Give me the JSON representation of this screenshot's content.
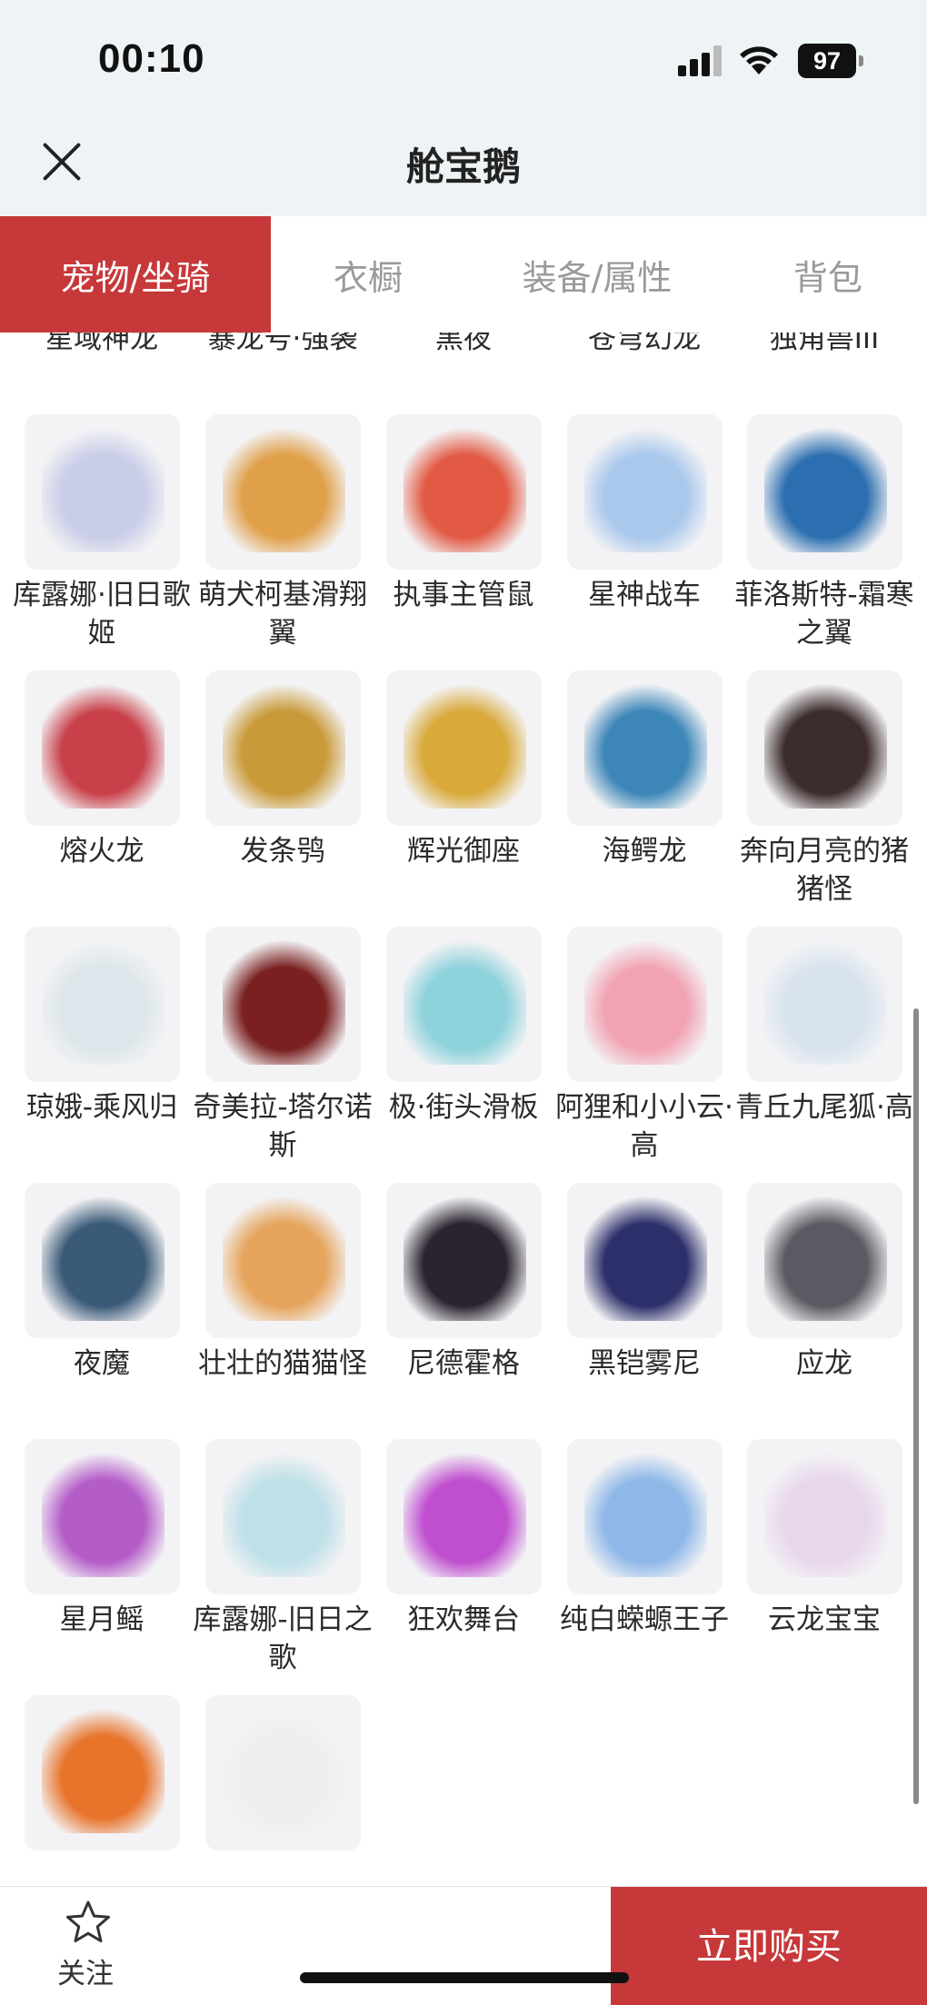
{
  "status_bar": {
    "time": "00:10",
    "battery": "97"
  },
  "header": {
    "title": "舱宝鹅",
    "close_icon": "close-icon"
  },
  "tabs": [
    {
      "label": "宠物/坐骑",
      "active": true
    },
    {
      "label": "衣橱",
      "active": false
    },
    {
      "label": "装备/属性",
      "active": false
    },
    {
      "label": "背包",
      "active": false
    }
  ],
  "items": [
    {
      "name": "星域神龙",
      "color": "#8a7ed8"
    },
    {
      "name": "暴龙号·强袭",
      "color": "#3a3a44"
    },
    {
      "name": "黑夜",
      "color": "#2a2d3a"
    },
    {
      "name": "苍穹幻龙",
      "color": "#d8c36a"
    },
    {
      "name": "独角兽III",
      "color": "#b3303c"
    },
    {
      "name": "库露娜·旧日歌姬",
      "color": "#c9cde8"
    },
    {
      "name": "萌犬柯基滑翔翼",
      "color": "#e0a04a"
    },
    {
      "name": "执事主管鼠",
      "color": "#e25a44"
    },
    {
      "name": "星神战车",
      "color": "#a9c8ec"
    },
    {
      "name": "菲洛斯特-霜寒之翼",
      "color": "#2c6fb0"
    },
    {
      "name": "熔火龙",
      "color": "#c8404a"
    },
    {
      "name": "发条鸮",
      "color": "#c99a3a"
    },
    {
      "name": "辉光御座",
      "color": "#d9a93a"
    },
    {
      "name": "海鳄龙",
      "color": "#3c86b8"
    },
    {
      "name": "奔向月亮的猪猪怪",
      "color": "#3c2c2c"
    },
    {
      "name": "琼娥-乘风归",
      "color": "#dde6ea"
    },
    {
      "name": "奇美拉-塔尔诺斯",
      "color": "#7a2020"
    },
    {
      "name": "极·街头滑板",
      "color": "#8ed2dc"
    },
    {
      "name": "阿狸和小小云·高",
      "color": "#f2a3b3"
    },
    {
      "name": "青丘九尾狐·高",
      "color": "#d8e3ee"
    },
    {
      "name": "夜魔",
      "color": "#3b5a78"
    },
    {
      "name": "壮壮的猫猫怪",
      "color": "#e6a45c"
    },
    {
      "name": "尼德霍格",
      "color": "#2b2430"
    },
    {
      "name": "黑铠雾尼",
      "color": "#2c2f6a"
    },
    {
      "name": "应龙",
      "color": "#5a5a62"
    },
    {
      "name": "星月鳐",
      "color": "#b45cc8"
    },
    {
      "name": "库露娜-旧日之歌",
      "color": "#bfe0e8"
    },
    {
      "name": "狂欢舞台",
      "color": "#c04fd0"
    },
    {
      "name": "纯白蝾螈王子",
      "color": "#8fb8e8"
    },
    {
      "name": "云龙宝宝",
      "color": "#e8d6ec"
    },
    {
      "name": "",
      "color": "#e8742c"
    },
    {
      "name": "",
      "color": "#eeeeee"
    }
  ],
  "bottom_bar": {
    "follow_label": "关注",
    "buy_label": "立即购买"
  },
  "colors": {
    "accent": "#c7383a",
    "header_bg": "#eef3f6"
  }
}
